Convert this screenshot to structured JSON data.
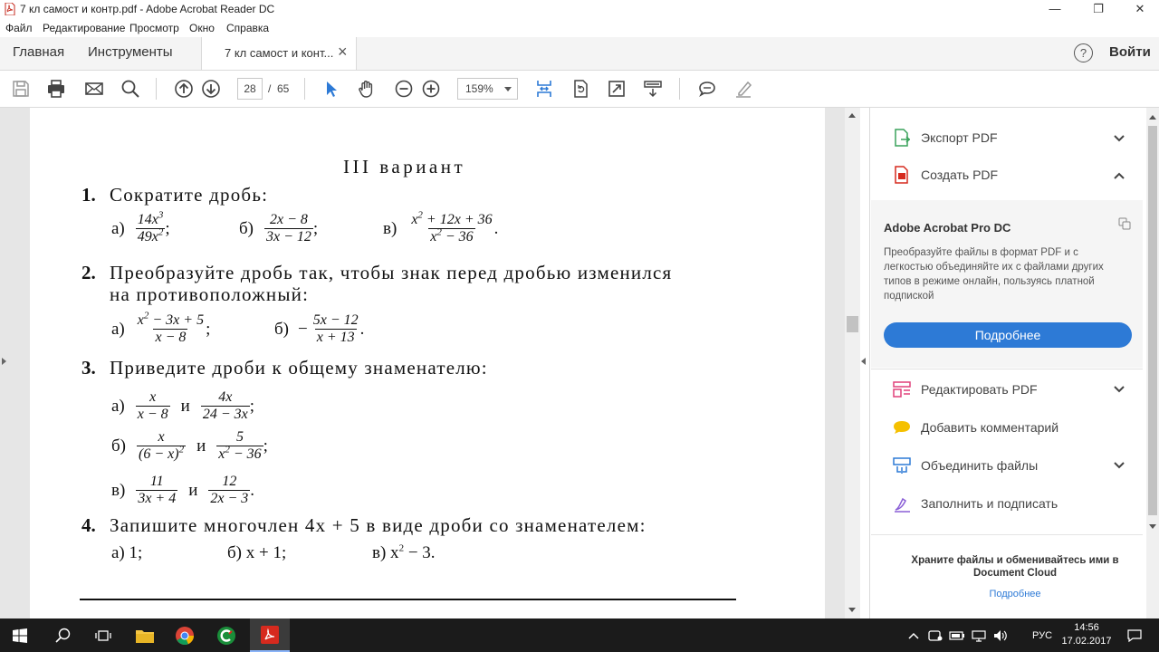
{
  "window": {
    "title": "7 кл самост и контр.pdf - Adobe Acrobat Reader DC",
    "minimize": "—",
    "maximize": "❐",
    "close": "✕"
  },
  "menu": [
    "Файл",
    "Редактирование",
    "Просмотр",
    "Окно",
    "Справка"
  ],
  "tabs": {
    "home": "Главная",
    "tools": "Инструменты",
    "document": "7 кл самост и конт...",
    "close": "×",
    "help": "?",
    "login": "Войти"
  },
  "toolbar": {
    "page_current": "28",
    "page_separator": "/",
    "page_total": "65",
    "zoom": "159%"
  },
  "document": {
    "variant": "III вариант",
    "q1": {
      "num": "1.",
      "text": "Сократите дробь:",
      "a": {
        "label": "а)",
        "num": "14x",
        "num_sup": "3",
        "den": "49x",
        "den_sup": "2",
        "punct": ";"
      },
      "b": {
        "label": "б)",
        "num": "2x − 8",
        "den": "3x − 12",
        "punct": ";"
      },
      "c": {
        "label": "в)",
        "num_pre": "x",
        "num_sup": "2",
        "num_post": " + 12x + 36",
        "den_pre": "x",
        "den_sup": "2",
        "den_post": " − 36",
        "punct": "."
      }
    },
    "q2": {
      "num": "2.",
      "text_line1": "Преобразуйте дробь так, чтобы знак перед дробью изменился",
      "text_line2": "на противоположный:",
      "a": {
        "label": "а)",
        "num_pre": "x",
        "num_sup": "2",
        "num_post": " − 3x + 5",
        "den": "x − 8",
        "punct": ";"
      },
      "b": {
        "label": "б)",
        "sign": "−",
        "num": "5x − 12",
        "den": "x + 13",
        "punct": "."
      }
    },
    "q3": {
      "num": "3.",
      "text": "Приведите дроби к общему знаменателю:",
      "and": "и",
      "a": {
        "label": "а)",
        "f1_num": "x",
        "f1_den": "x − 8",
        "f2_num": "4x",
        "f2_den": "24 − 3x",
        "punct": ";"
      },
      "b": {
        "label": "б)",
        "f1_num": "x",
        "f1_den_pre": "(6 − x)",
        "f1_den_sup": "2",
        "f2_num": "5",
        "f2_den_pre": "x",
        "f2_den_sup": "2",
        "f2_den_post": " − 36",
        "punct": ";"
      },
      "c": {
        "label": "в)",
        "f1_num": "11",
        "f1_den": "3x + 4",
        "f2_num": "12",
        "f2_den": "2x − 3",
        "punct": "."
      }
    },
    "q4": {
      "num": "4.",
      "text": "Запишите многочлен 4x + 5 в виде дроби со знаменателем:",
      "a": "а)  1;",
      "b": "б)  x + 1;",
      "c_pre": "в)  x",
      "c_sup": "2",
      "c_post": " − 3."
    }
  },
  "right_panel": {
    "export_pdf": "Экспорт PDF",
    "create_pdf": "Создать PDF",
    "promo_title": "Adobe Acrobat Pro DC",
    "promo_text": "Преобразуйте файлы в формат PDF и с легкостью объединяйте их с файлами других типов в режиме онлайн, пользуясь платной подпиской",
    "promo_button": "Подробнее",
    "edit_pdf": "Редактировать PDF",
    "add_comment": "Добавить комментарий",
    "combine_files": "Объединить файлы",
    "fill_sign": "Заполнить и подписать",
    "cloud_text": "Храните файлы и обменивайтесь ими в Document Cloud",
    "cloud_link": "Подробнее"
  },
  "taskbar": {
    "language": "РУС",
    "time": "14:56",
    "date": "17.02.2017"
  },
  "colors": {
    "accent_blue": "#2d7ad6",
    "pdf_red": "#d62a1e",
    "taskbar": "#1b1b1b"
  }
}
